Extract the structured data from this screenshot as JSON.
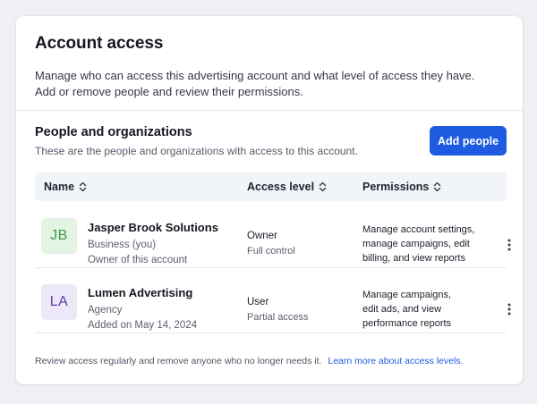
{
  "header": {
    "title": "Account access",
    "description_line1": "Manage who can access this advertising account and what level of access they have.",
    "description_line2": "Add or remove people and review their permissions."
  },
  "section": {
    "title": "People and organizations",
    "subtitle": "These are the people and organizations with access to this account.",
    "add_button": "Add people"
  },
  "table": {
    "columns": [
      "Name",
      "Access level",
      "Permissions"
    ],
    "rows": [
      {
        "initials": "JB",
        "avatar_bg": "#e3f3e4",
        "avatar_fg": "#3f9a4f",
        "name": "Jasper Brook Solutions",
        "meta1": "Business (you)",
        "meta2": "Owner of this account",
        "access": "Owner",
        "access_sub": "Full control",
        "perm_lines": [
          "Manage account settings,",
          "manage campaigns, edit",
          "billing, and view reports"
        ]
      },
      {
        "initials": "LA",
        "avatar_bg": "#ece8f8",
        "avatar_fg": "#5b3fa8",
        "name": "Lumen Advertising",
        "meta1": "Agency",
        "meta2": "Added on May 14, 2024",
        "access": "User",
        "access_sub": "Partial access",
        "perm_lines": [
          "Manage campaigns,",
          "edit ads, and view",
          "performance reports"
        ]
      }
    ]
  },
  "footer": {
    "text": "Review access regularly and remove anyone who no longer needs it.",
    "link": "Learn more about access levels."
  },
  "colors": {
    "accent": "#1e5be0",
    "page_bg": "#eef0f5",
    "header_row_bg": "#f1f4f9"
  },
  "icons": {
    "sort": "sort-updown-icon",
    "row_menu": "more-vertical-icon"
  }
}
